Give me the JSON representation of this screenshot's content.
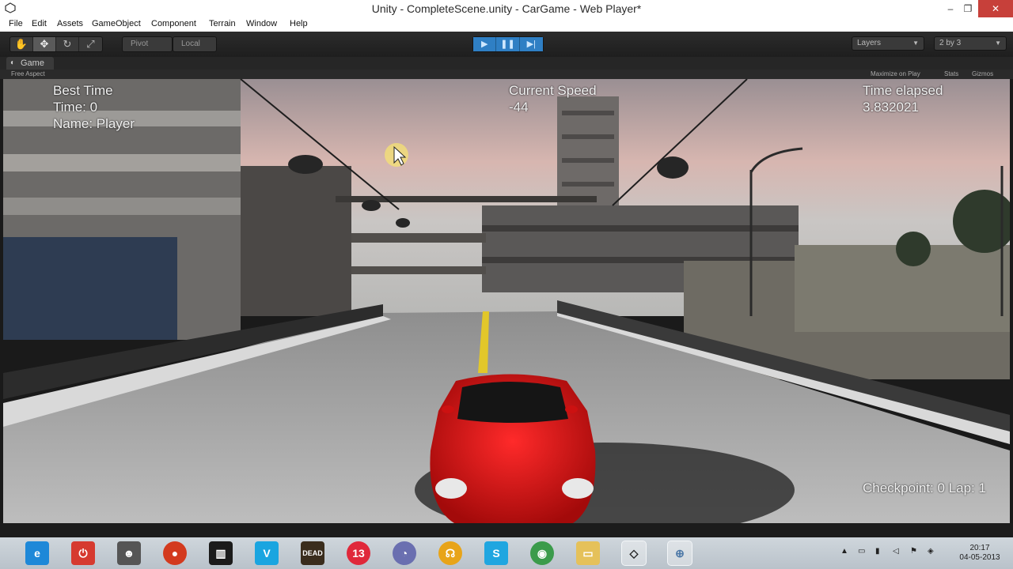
{
  "window": {
    "title": "Unity - CompleteScene.unity - CarGame - Web Player*",
    "minimize": "–",
    "maximize": "❐",
    "close": "✕"
  },
  "menu": [
    "File",
    "Edit",
    "Assets",
    "GameObject",
    "Component",
    "Terrain",
    "Window",
    "Help"
  ],
  "toolbar": {
    "tools": [
      "hand-icon",
      "move-icon",
      "rotate-icon",
      "scale-icon"
    ],
    "pivot_label": "Pivot",
    "local_label": "Local",
    "play": "▶",
    "pause": "❚❚",
    "step": "▶|",
    "layers_label": "Layers",
    "layout_label": "2 by 3"
  },
  "game_panel": {
    "tab_label": "Game",
    "aspect": "Free Aspect",
    "options": [
      "Maximize on Play",
      "Stats",
      "Gizmos"
    ]
  },
  "hud": {
    "best_time_title": "Best Time",
    "best_time_value": "Time: 0",
    "best_time_name": "Name: Player",
    "speed_title": "Current Speed",
    "speed_value": "-44",
    "elapsed_title": "Time elapsed",
    "elapsed_value": "3.832021",
    "checkpoint": "Checkpoint: 0 Lap: 1"
  },
  "taskbar": {
    "items": [
      {
        "name": "internet-explorer-icon",
        "color": "#1e88d8"
      },
      {
        "name": "power-app-icon",
        "color": "#d63a2f"
      },
      {
        "name": "hacker-app-icon",
        "color": "#555555"
      },
      {
        "name": "round-red-app-icon",
        "color": "#d33a1e"
      },
      {
        "name": "equalizer-app-icon",
        "color": "#1b1b1b"
      },
      {
        "name": "v-app-icon",
        "color": "#1aa5e0"
      },
      {
        "name": "dead-game-icon",
        "color": "#3a2d1d"
      },
      {
        "name": "number13-app-icon",
        "color": "#e0283a"
      },
      {
        "name": "chart-app-icon",
        "color": "#6a6fb0"
      },
      {
        "name": "headphones-app-icon",
        "color": "#e8a419"
      },
      {
        "name": "skype-icon",
        "color": "#20a6e0"
      },
      {
        "name": "chrome-icon",
        "color": "#3b9b4b"
      },
      {
        "name": "folder-icon",
        "color": "#e5c15a"
      },
      {
        "name": "unity-icon",
        "color": "#222222"
      },
      {
        "name": "network-app-icon",
        "color": "#4f7aa8"
      }
    ],
    "dead_label": "DEAD",
    "thirteen_label": "13",
    "v_label": "V",
    "skype_label": "S",
    "tray_up": "▲",
    "time": "20:17",
    "date": "04-05-2013"
  }
}
